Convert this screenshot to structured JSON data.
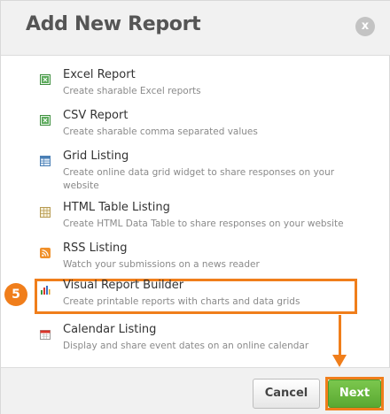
{
  "dialog": {
    "title": "Add New Report",
    "close_label": "x"
  },
  "reports": [
    {
      "name": "Excel Report",
      "desc": "Create sharable Excel reports",
      "icon": "excel-icon"
    },
    {
      "name": "CSV Report",
      "desc": "Create sharable comma separated values",
      "icon": "csv-icon"
    },
    {
      "name": "Grid Listing",
      "desc": "Create online data grid widget to share responses on your website",
      "icon": "grid-icon"
    },
    {
      "name": "HTML Table Listing",
      "desc": "Create HTML Data Table to share responses on your website",
      "icon": "html-table-icon"
    },
    {
      "name": "RSS Listing",
      "desc": "Watch your submissions on a news reader",
      "icon": "rss-icon"
    },
    {
      "name": "Visual Report Builder",
      "desc": "Create printable reports with charts and data grids",
      "icon": "bar-chart-icon"
    },
    {
      "name": "Calendar Listing",
      "desc": "Display and share event dates on an online calendar",
      "icon": "calendar-icon"
    }
  ],
  "step_badge": "5",
  "footer": {
    "cancel_label": "Cancel",
    "next_label": "Next"
  },
  "colors": {
    "accent": "#f07e1b",
    "next_button": "#5aa832"
  }
}
